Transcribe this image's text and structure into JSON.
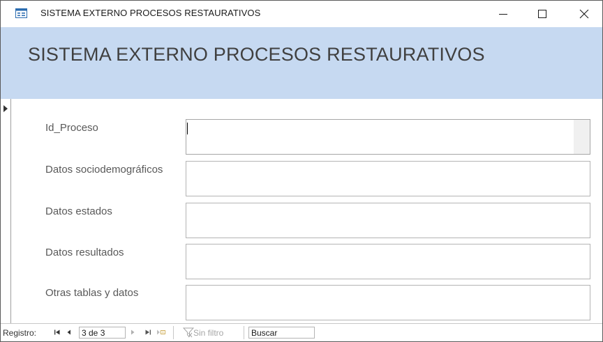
{
  "window": {
    "title": "SISTEMA EXTERNO PROCESOS RESTAURATIVOS",
    "icon": "access-form-icon",
    "controls": [
      "minimize-icon",
      "maximize-icon",
      "close-icon"
    ]
  },
  "header": {
    "title": "SISTEMA EXTERNO PROCESOS RESTAURATIVOS",
    "background": "#c6d9f1"
  },
  "form": {
    "fields": [
      {
        "label": "Id_Proceso",
        "value": ""
      },
      {
        "label": "Datos sociodemográficos",
        "value": ""
      },
      {
        "label": "Datos estados",
        "value": ""
      },
      {
        "label": "Datos resultados",
        "value": ""
      },
      {
        "label": "Otras tablas y datos",
        "value": ""
      }
    ]
  },
  "navigation": {
    "label": "Registro:",
    "current": "3 de 3",
    "filter_label": "Sin filtro",
    "search_placeholder": "Buscar"
  }
}
